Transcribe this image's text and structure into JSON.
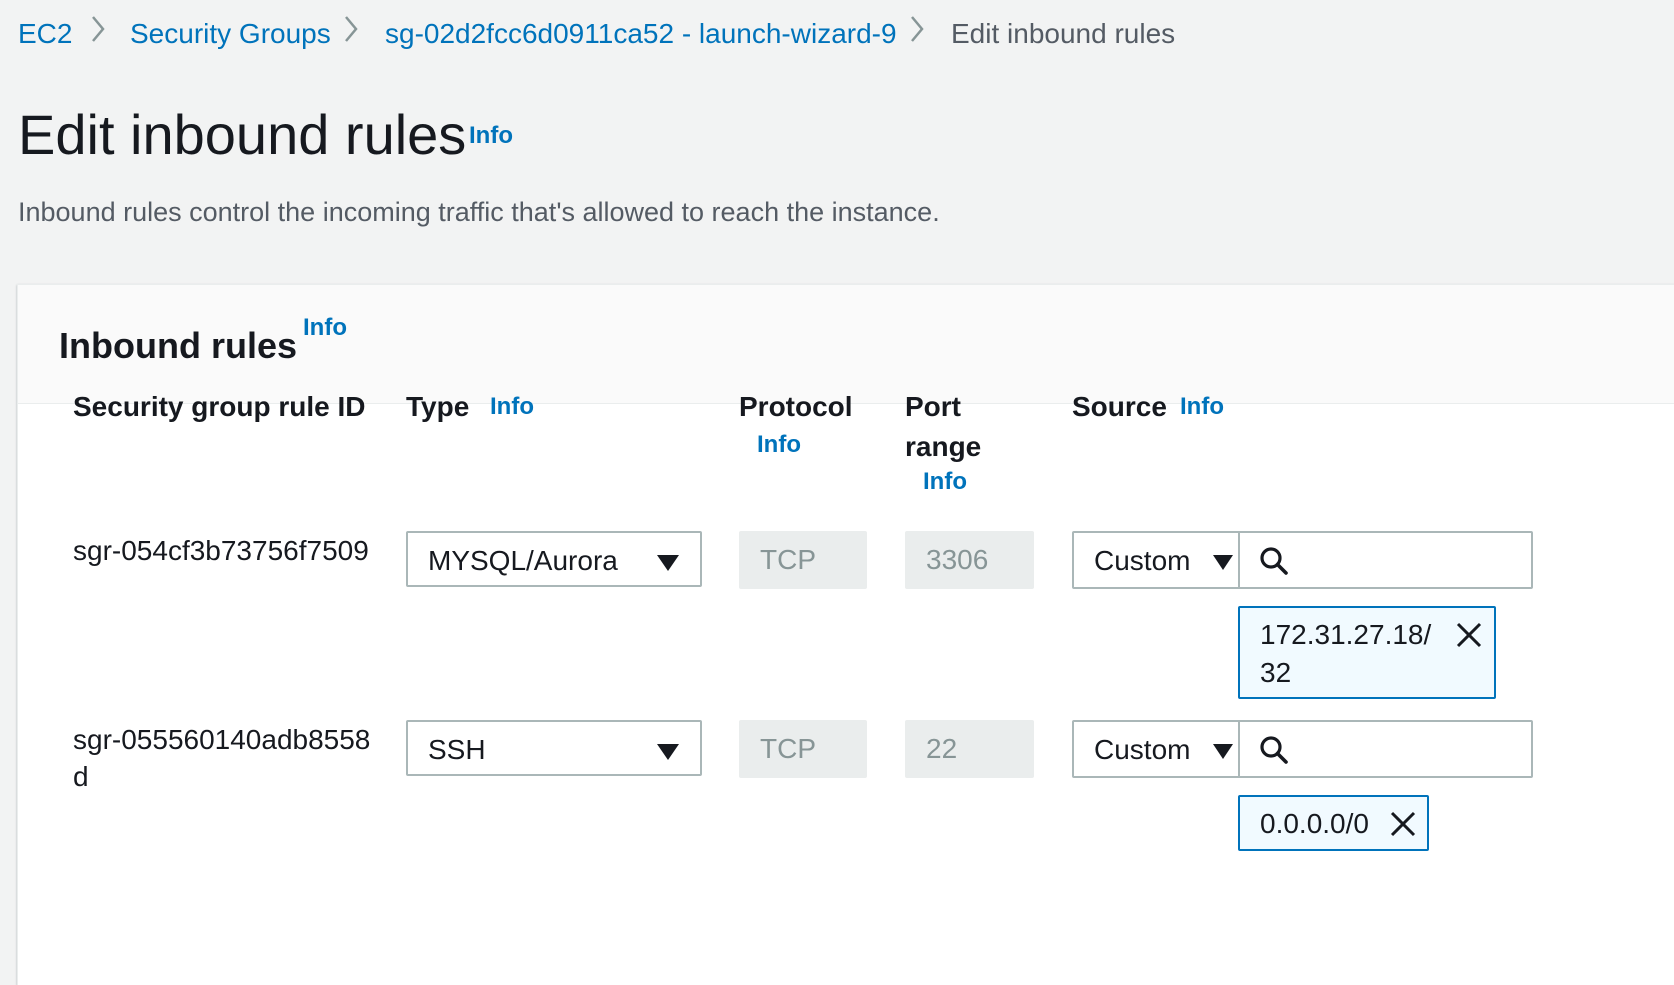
{
  "breadcrumb": {
    "items": [
      "EC2",
      "Security Groups",
      "sg-02d2fcc6d0911ca52 - launch-wizard-9"
    ],
    "current": "Edit inbound rules"
  },
  "page": {
    "title": "Edit inbound rules",
    "title_info": "Info",
    "description": "Inbound rules control the incoming traffic that's allowed to reach the instance."
  },
  "panel": {
    "title": "Inbound rules",
    "info": "Info"
  },
  "columns": {
    "rule_id": "Security group rule ID",
    "type": "Type",
    "type_info": "Info",
    "protocol": "Protocol",
    "protocol_info": "Info",
    "port_line1": "Port",
    "port_line2": "range",
    "port_info": "Info",
    "source": "Source",
    "source_info": "Info"
  },
  "rules": [
    {
      "id": "sgr-054cf3b73756f7509",
      "type": "MYSQL/Aurora",
      "protocol": "TCP",
      "port": "3306",
      "source_type": "Custom",
      "token_line1": "172.31.27.18/",
      "token_line2": "32"
    },
    {
      "id_line1": "sgr-055560140adb8558",
      "id_line2": "d",
      "type": "SSH",
      "protocol": "TCP",
      "port": "22",
      "source_type": "Custom",
      "token": "0.0.0.0/0"
    }
  ],
  "icons": {
    "breadcrumb_separator": "chevron-right-icon",
    "dropdown": "caret-down-icon",
    "search": "search-icon",
    "remove": "close-icon"
  },
  "colors": {
    "link": "#0073bb",
    "background": "#f2f3f3",
    "token_border": "#0073bb",
    "token_fill": "#f1faff"
  }
}
